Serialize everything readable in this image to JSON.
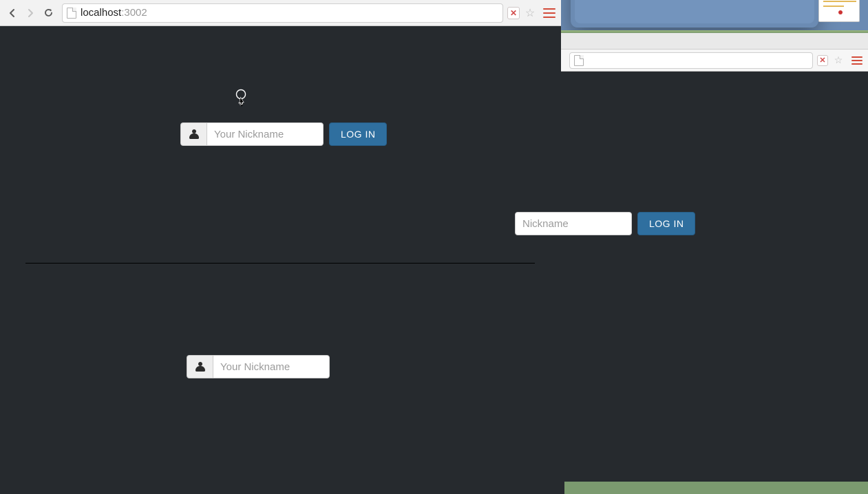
{
  "browser": {
    "url_host": "localhost",
    "url_port": ":3002"
  },
  "login": {
    "placeholder": "Your Nickname",
    "placeholder_cropped": "Nickname",
    "button_label": "LOG IN"
  }
}
